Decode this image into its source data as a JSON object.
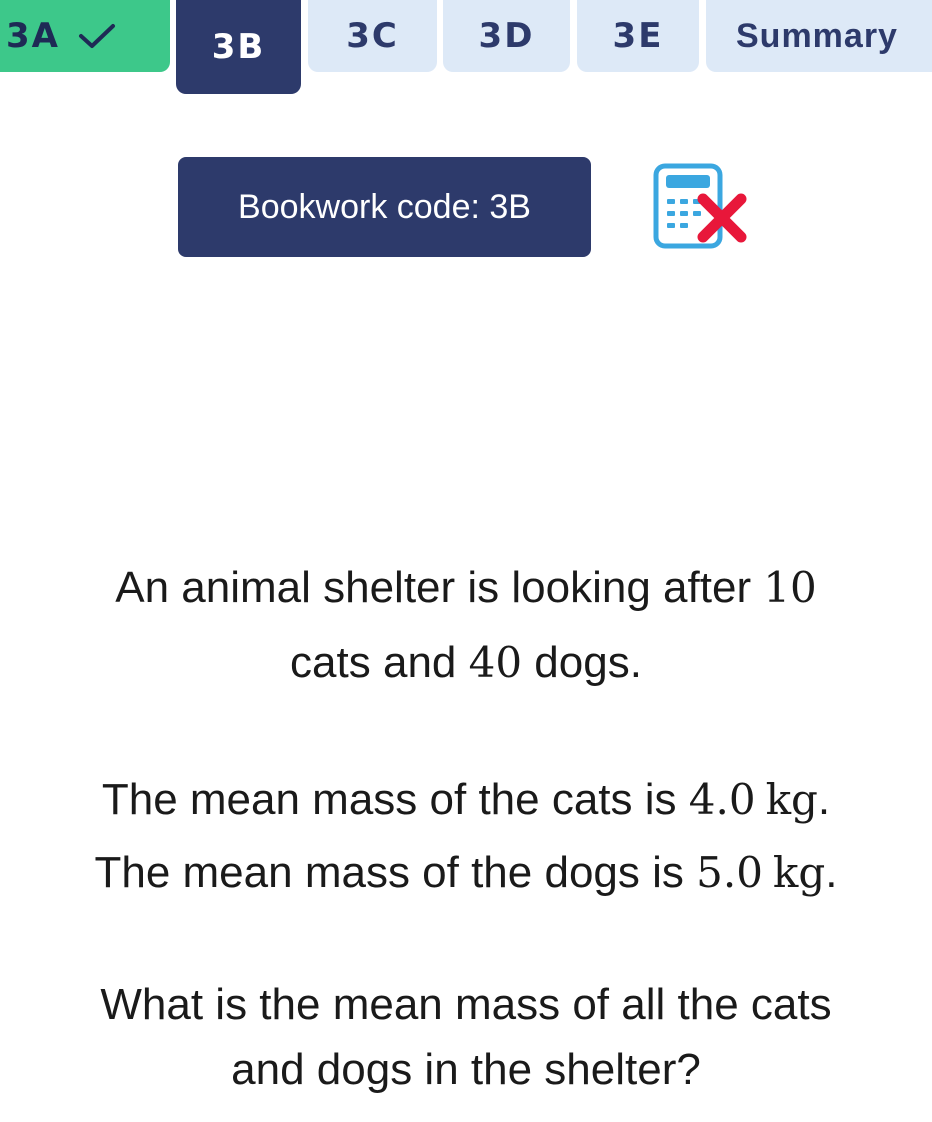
{
  "tabs": [
    {
      "label": "3A",
      "state": "done"
    },
    {
      "label": "3B",
      "state": "active"
    },
    {
      "label": "3C",
      "state": "pending"
    },
    {
      "label": "3D",
      "state": "pending"
    },
    {
      "label": "3E",
      "state": "pending"
    },
    {
      "label": "Summary",
      "state": "pending"
    }
  ],
  "bookwork": {
    "label": "Bookwork code: 3B"
  },
  "calculator": {
    "icon": "calculator-not-allowed-icon",
    "status": "not allowed"
  },
  "question": {
    "line1_pre": "An animal shelter is looking after ",
    "cats_count": "10",
    "line2_pre": "cats and ",
    "dogs_count": "40",
    "line2_post": " dogs.",
    "line3_pre": "The mean mass of the cats is ",
    "cats_mean": "4.0",
    "unit_cats": "kg",
    "line3_post": ".",
    "line4_pre": "The mean mass of the dogs is ",
    "dogs_mean": "5.0",
    "unit_dogs": "kg",
    "line4_post": ".",
    "line5": "What is the mean mass of all the cats",
    "line6": "and dogs in the shelter?"
  },
  "colors": {
    "tab_done": "#3dc88a",
    "tab_active": "#2d3a6b",
    "tab_pending": "#dde9f7",
    "accent_red": "#e8173a"
  }
}
